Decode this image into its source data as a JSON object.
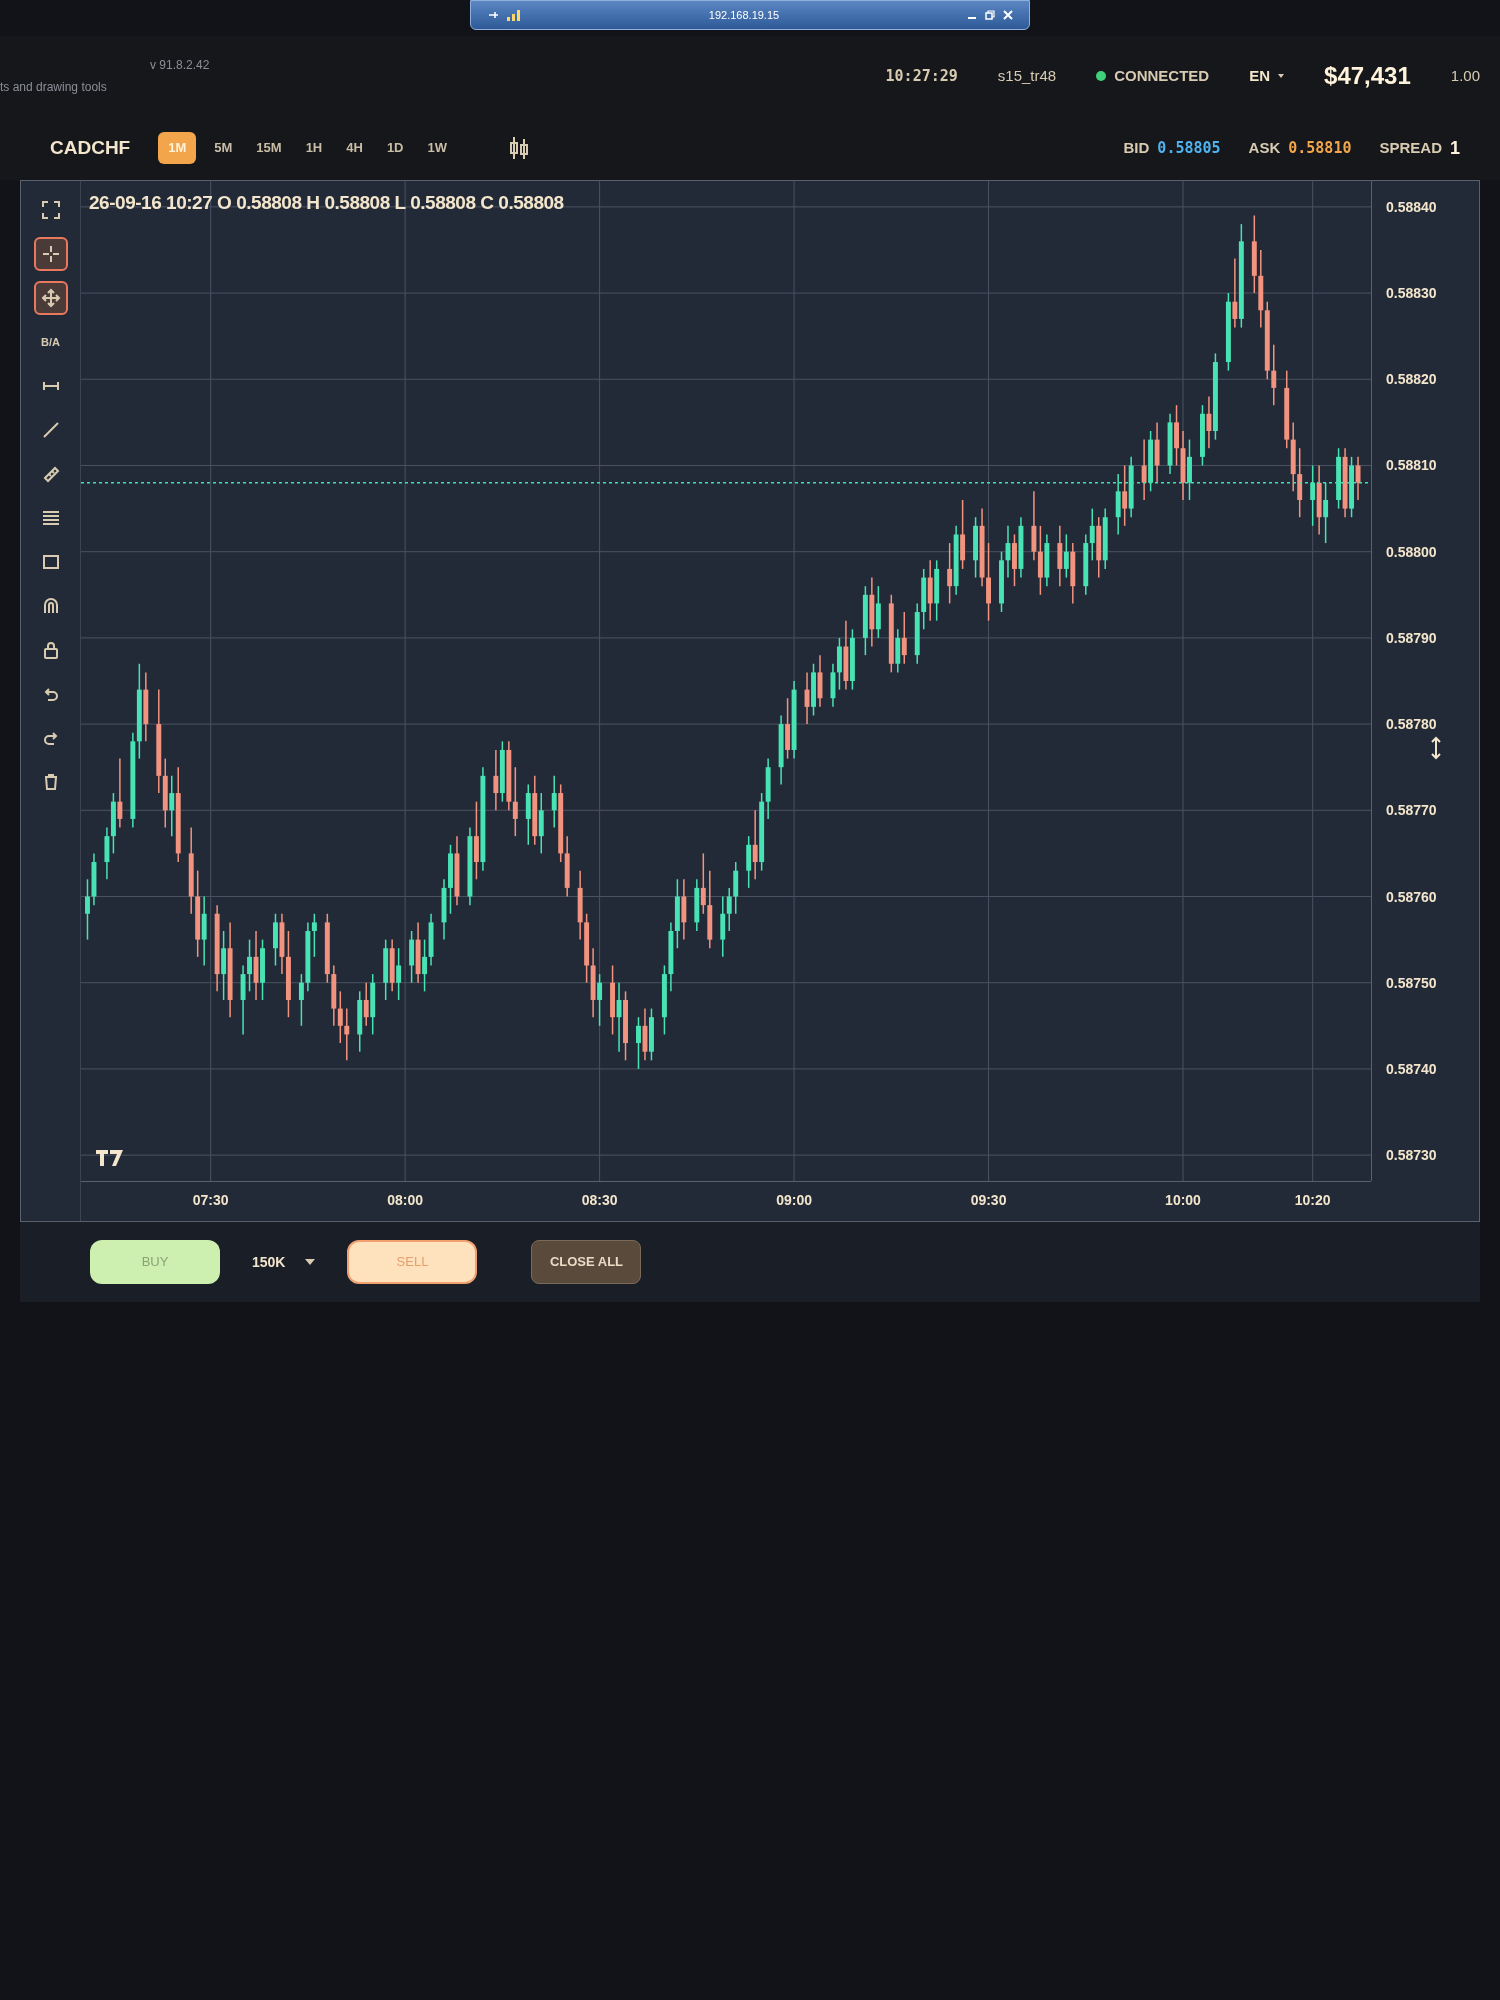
{
  "remote_bar": {
    "title": "192.168.19.15"
  },
  "header": {
    "tools_hint": "ts and drawing tools",
    "version": "v 91.8.2.42",
    "time": "10:27:29",
    "user": "s15_tr48",
    "connection": {
      "label": "CONNECTED",
      "connected": true
    },
    "language": "EN",
    "balance": "$47,431",
    "leverage": "1.00"
  },
  "toolbar": {
    "symbol": "CADCHF",
    "timeframes": [
      {
        "label": "1M",
        "selected": true
      },
      {
        "label": "5M",
        "selected": false
      },
      {
        "label": "15M",
        "selected": false
      },
      {
        "label": "1H",
        "selected": false
      },
      {
        "label": "4H",
        "selected": false
      },
      {
        "label": "1D",
        "selected": false
      },
      {
        "label": "1W",
        "selected": false
      }
    ],
    "quote": {
      "bid_label": "BID",
      "bid": "0.58805",
      "ask_label": "ASK",
      "ask": "0.58810",
      "spread_label": "SPREAD",
      "spread": "1"
    }
  },
  "drawing_tools": [
    {
      "kind": "icon",
      "selected": false
    },
    {
      "kind": "icon",
      "selected": true
    },
    {
      "kind": "icon",
      "selected": true
    },
    {
      "kind": "text",
      "label": "B/A",
      "selected": false
    },
    {
      "kind": "icon",
      "selected": false
    },
    {
      "kind": "icon",
      "selected": false
    },
    {
      "kind": "icon",
      "selected": false
    },
    {
      "kind": "icon",
      "selected": false
    },
    {
      "kind": "icon",
      "selected": false
    },
    {
      "kind": "icon",
      "selected": false
    },
    {
      "kind": "icon",
      "selected": false
    },
    {
      "kind": "icon",
      "selected": false
    },
    {
      "kind": "icon",
      "selected": false
    },
    {
      "kind": "icon",
      "selected": false
    }
  ],
  "chart": {
    "ohlc": "26-09-16 10:27 O 0.58808 H 0.58808 L 0.58808 C 0.58808",
    "chart_data": {
      "type": "candlestick",
      "xlim": [
        430,
        629
      ],
      "ylim": [
        0.58727,
        0.58843
      ],
      "grid": true,
      "ref_lines": [
        {
          "axis": "y",
          "value": 0.58808
        }
      ],
      "yticks": [
        {
          "value": 0.5884,
          "label": "0.58840"
        },
        {
          "value": 0.5883,
          "label": "0.58830"
        },
        {
          "value": 0.5882,
          "label": "0.58820"
        },
        {
          "value": 0.5881,
          "label": "0.58810"
        },
        {
          "value": 0.588,
          "label": "0.58800"
        },
        {
          "value": 0.5879,
          "label": "0.58790"
        },
        {
          "value": 0.5878,
          "label": "0.58780"
        },
        {
          "value": 0.5877,
          "label": "0.58770"
        },
        {
          "value": 0.5876,
          "label": "0.58760"
        },
        {
          "value": 0.5875,
          "label": "0.58750"
        },
        {
          "value": 0.5874,
          "label": "0.58740"
        },
        {
          "value": 0.5873,
          "label": "0.58730"
        }
      ],
      "xticks": [
        {
          "value": 450,
          "label": "07:30"
        },
        {
          "value": 480,
          "label": "08:00"
        },
        {
          "value": 510,
          "label": "08:30"
        },
        {
          "value": 540,
          "label": "09:00"
        },
        {
          "value": 570,
          "label": "09:30"
        },
        {
          "value": 600,
          "label": "10:00"
        },
        {
          "value": 620,
          "label": "10:20"
        }
      ],
      "x": [
        431,
        432,
        434,
        435,
        436,
        438,
        439,
        440,
        442,
        443,
        444,
        445,
        447,
        448,
        449,
        451,
        452,
        453,
        455,
        456,
        457,
        458,
        460,
        461,
        462,
        464,
        465,
        466,
        468,
        469,
        470,
        471,
        473,
        474,
        475,
        477,
        478,
        479,
        481,
        482,
        483,
        484,
        486,
        487,
        488,
        490,
        491,
        492,
        494,
        495,
        496,
        497,
        499,
        500,
        501,
        503,
        504,
        505,
        507,
        508,
        509,
        510,
        512,
        513,
        514,
        516,
        517,
        518,
        520,
        521,
        522,
        523,
        525,
        526,
        527,
        529,
        530,
        531,
        533,
        534,
        535,
        536,
        538,
        539,
        540,
        542,
        543,
        544,
        546,
        547,
        548,
        549,
        551,
        552,
        553,
        555,
        556,
        557,
        559,
        560,
        561,
        562,
        564,
        565,
        566,
        568,
        569,
        570,
        572,
        573,
        574,
        575,
        577,
        578,
        579,
        581,
        582,
        583,
        585,
        586,
        587,
        588,
        590,
        591,
        592,
        594,
        595,
        596,
        598,
        599,
        600,
        601,
        603,
        604,
        605,
        607,
        608,
        609,
        611,
        612,
        613,
        614,
        616,
        617,
        618,
        620,
        621,
        622,
        624,
        625,
        626,
        627
      ],
      "ohlc": [
        [
          0.58758,
          0.58762,
          0.58755,
          0.5876
        ],
        [
          0.5876,
          0.58765,
          0.58759,
          0.58764
        ],
        [
          0.58764,
          0.58768,
          0.58762,
          0.58767
        ],
        [
          0.58767,
          0.58772,
          0.58765,
          0.58771
        ],
        [
          0.58771,
          0.58776,
          0.58768,
          0.58769
        ],
        [
          0.58769,
          0.58779,
          0.58768,
          0.58778
        ],
        [
          0.58778,
          0.58787,
          0.58776,
          0.58784
        ],
        [
          0.58784,
          0.58786,
          0.58778,
          0.5878
        ],
        [
          0.5878,
          0.58784,
          0.58772,
          0.58774
        ],
        [
          0.58774,
          0.58776,
          0.58768,
          0.5877
        ],
        [
          0.5877,
          0.58774,
          0.58767,
          0.58772
        ],
        [
          0.58772,
          0.58775,
          0.58764,
          0.58765
        ],
        [
          0.58765,
          0.58768,
          0.58758,
          0.5876
        ],
        [
          0.5876,
          0.58763,
          0.58753,
          0.58755
        ],
        [
          0.58755,
          0.5876,
          0.58752,
          0.58758
        ],
        [
          0.58758,
          0.58759,
          0.58749,
          0.58751
        ],
        [
          0.58751,
          0.58756,
          0.58748,
          0.58754
        ],
        [
          0.58754,
          0.58757,
          0.58746,
          0.58748
        ],
        [
          0.58748,
          0.58752,
          0.58744,
          0.58751
        ],
        [
          0.58751,
          0.58755,
          0.58749,
          0.58753
        ],
        [
          0.58753,
          0.58756,
          0.58748,
          0.5875
        ],
        [
          0.5875,
          0.58755,
          0.58748,
          0.58754
        ],
        [
          0.58754,
          0.58758,
          0.58752,
          0.58757
        ],
        [
          0.58757,
          0.58758,
          0.58751,
          0.58753
        ],
        [
          0.58753,
          0.58756,
          0.58746,
          0.58748
        ],
        [
          0.58748,
          0.58751,
          0.58745,
          0.5875
        ],
        [
          0.5875,
          0.58757,
          0.58749,
          0.58756
        ],
        [
          0.58756,
          0.58758,
          0.58753,
          0.58757
        ],
        [
          0.58757,
          0.58758,
          0.5875,
          0.58751
        ],
        [
          0.58751,
          0.58752,
          0.58745,
          0.58747
        ],
        [
          0.58747,
          0.58749,
          0.58743,
          0.58745
        ],
        [
          0.58745,
          0.58747,
          0.58741,
          0.58744
        ],
        [
          0.58744,
          0.58749,
          0.58742,
          0.58748
        ],
        [
          0.58748,
          0.5875,
          0.58745,
          0.58746
        ],
        [
          0.58746,
          0.58751,
          0.58744,
          0.5875
        ],
        [
          0.5875,
          0.58755,
          0.58748,
          0.58754
        ],
        [
          0.58754,
          0.58755,
          0.58749,
          0.5875
        ],
        [
          0.5875,
          0.58754,
          0.58748,
          0.58752
        ],
        [
          0.58752,
          0.58756,
          0.5875,
          0.58755
        ],
        [
          0.58755,
          0.58757,
          0.5875,
          0.58751
        ],
        [
          0.58751,
          0.58755,
          0.58749,
          0.58753
        ],
        [
          0.58753,
          0.58758,
          0.58752,
          0.58757
        ],
        [
          0.58757,
          0.58762,
          0.58755,
          0.58761
        ],
        [
          0.58761,
          0.58766,
          0.58758,
          0.58765
        ],
        [
          0.58765,
          0.58767,
          0.58759,
          0.5876
        ],
        [
          0.5876,
          0.58768,
          0.58759,
          0.58767
        ],
        [
          0.58767,
          0.58771,
          0.58762,
          0.58764
        ],
        [
          0.58764,
          0.58775,
          0.58763,
          0.58774
        ],
        [
          0.58774,
          0.58777,
          0.5877,
          0.58772
        ],
        [
          0.58772,
          0.58778,
          0.58771,
          0.58777
        ],
        [
          0.58777,
          0.58778,
          0.5877,
          0.58771
        ],
        [
          0.58771,
          0.58775,
          0.58767,
          0.58769
        ],
        [
          0.58769,
          0.58773,
          0.58766,
          0.58772
        ],
        [
          0.58772,
          0.58774,
          0.58766,
          0.58767
        ],
        [
          0.58767,
          0.58772,
          0.58765,
          0.5877
        ],
        [
          0.5877,
          0.58774,
          0.58768,
          0.58772
        ],
        [
          0.58772,
          0.58773,
          0.58764,
          0.58765
        ],
        [
          0.58765,
          0.58767,
          0.5876,
          0.58761
        ],
        [
          0.58761,
          0.58763,
          0.58755,
          0.58757
        ],
        [
          0.58757,
          0.58758,
          0.5875,
          0.58752
        ],
        [
          0.58752,
          0.58754,
          0.58746,
          0.58748
        ],
        [
          0.58748,
          0.58751,
          0.58745,
          0.5875
        ],
        [
          0.5875,
          0.58752,
          0.58744,
          0.58746
        ],
        [
          0.58746,
          0.5875,
          0.58742,
          0.58748
        ],
        [
          0.58748,
          0.58749,
          0.58741,
          0.58743
        ],
        [
          0.58743,
          0.58746,
          0.5874,
          0.58745
        ],
        [
          0.58745,
          0.58747,
          0.58741,
          0.58742
        ],
        [
          0.58742,
          0.58747,
          0.58741,
          0.58746
        ],
        [
          0.58746,
          0.58752,
          0.58744,
          0.58751
        ],
        [
          0.58751,
          0.58757,
          0.58749,
          0.58756
        ],
        [
          0.58756,
          0.58762,
          0.58754,
          0.5876
        ],
        [
          0.5876,
          0.58762,
          0.58755,
          0.58757
        ],
        [
          0.58757,
          0.58762,
          0.58756,
          0.58761
        ],
        [
          0.58761,
          0.58765,
          0.58758,
          0.58759
        ],
        [
          0.58759,
          0.58763,
          0.58754,
          0.58755
        ],
        [
          0.58755,
          0.5876,
          0.58753,
          0.58758
        ],
        [
          0.58758,
          0.58761,
          0.58756,
          0.5876
        ],
        [
          0.5876,
          0.58764,
          0.58758,
          0.58763
        ],
        [
          0.58763,
          0.58767,
          0.58761,
          0.58766
        ],
        [
          0.58766,
          0.5877,
          0.58762,
          0.58764
        ],
        [
          0.58764,
          0.58772,
          0.58763,
          0.58771
        ],
        [
          0.58771,
          0.58776,
          0.58769,
          0.58775
        ],
        [
          0.58775,
          0.58781,
          0.58773,
          0.5878
        ],
        [
          0.5878,
          0.58783,
          0.58776,
          0.58777
        ],
        [
          0.58777,
          0.58785,
          0.58776,
          0.58784
        ],
        [
          0.58784,
          0.58786,
          0.5878,
          0.58782
        ],
        [
          0.58782,
          0.58787,
          0.58781,
          0.58786
        ],
        [
          0.58786,
          0.58788,
          0.58782,
          0.58783
        ],
        [
          0.58783,
          0.58787,
          0.58782,
          0.58786
        ],
        [
          0.58786,
          0.5879,
          0.58784,
          0.58789
        ],
        [
          0.58789,
          0.58792,
          0.58784,
          0.58785
        ],
        [
          0.58785,
          0.58791,
          0.58784,
          0.5879
        ],
        [
          0.5879,
          0.58796,
          0.58788,
          0.58795
        ],
        [
          0.58795,
          0.58797,
          0.58789,
          0.58791
        ],
        [
          0.58791,
          0.58796,
          0.5879,
          0.58794
        ],
        [
          0.58794,
          0.58795,
          0.58786,
          0.58787
        ],
        [
          0.58787,
          0.58791,
          0.58786,
          0.5879
        ],
        [
          0.5879,
          0.58793,
          0.58787,
          0.58788
        ],
        [
          0.58788,
          0.58794,
          0.58787,
          0.58793
        ],
        [
          0.58793,
          0.58798,
          0.58791,
          0.58797
        ],
        [
          0.58797,
          0.58799,
          0.58792,
          0.58794
        ],
        [
          0.58794,
          0.58799,
          0.58792,
          0.58798
        ],
        [
          0.58798,
          0.58801,
          0.58794,
          0.58796
        ],
        [
          0.58796,
          0.58803,
          0.58795,
          0.58802
        ],
        [
          0.58802,
          0.58806,
          0.58798,
          0.58799
        ],
        [
          0.58799,
          0.58804,
          0.58797,
          0.58803
        ],
        [
          0.58803,
          0.58805,
          0.58796,
          0.58797
        ],
        [
          0.58797,
          0.58801,
          0.58792,
          0.58794
        ],
        [
          0.58794,
          0.588,
          0.58793,
          0.58799
        ],
        [
          0.58799,
          0.58803,
          0.58797,
          0.58801
        ],
        [
          0.58801,
          0.58802,
          0.58796,
          0.58798
        ],
        [
          0.58798,
          0.58804,
          0.58797,
          0.58803
        ],
        [
          0.58803,
          0.58807,
          0.58799,
          0.588
        ],
        [
          0.588,
          0.58803,
          0.58795,
          0.58797
        ],
        [
          0.58797,
          0.58802,
          0.58796,
          0.58801
        ],
        [
          0.58801,
          0.58803,
          0.58796,
          0.58798
        ],
        [
          0.58798,
          0.58802,
          0.58797,
          0.588
        ],
        [
          0.588,
          0.58801,
          0.58794,
          0.58796
        ],
        [
          0.58796,
          0.58802,
          0.58795,
          0.58801
        ],
        [
          0.58801,
          0.58805,
          0.58799,
          0.58803
        ],
        [
          0.58803,
          0.58804,
          0.58797,
          0.58799
        ],
        [
          0.58799,
          0.58805,
          0.58798,
          0.58804
        ],
        [
          0.58804,
          0.58809,
          0.58802,
          0.58807
        ],
        [
          0.58807,
          0.5881,
          0.58803,
          0.58805
        ],
        [
          0.58805,
          0.58811,
          0.58804,
          0.5881
        ],
        [
          0.5881,
          0.58813,
          0.58806,
          0.58808
        ],
        [
          0.58808,
          0.58814,
          0.58807,
          0.58813
        ],
        [
          0.58813,
          0.58815,
          0.58808,
          0.5881
        ],
        [
          0.5881,
          0.58816,
          0.58809,
          0.58815
        ],
        [
          0.58815,
          0.58817,
          0.5881,
          0.58812
        ],
        [
          0.58812,
          0.58814,
          0.58806,
          0.58808
        ],
        [
          0.58808,
          0.58813,
          0.58806,
          0.58811
        ],
        [
          0.58811,
          0.58817,
          0.5881,
          0.58816
        ],
        [
          0.58816,
          0.58818,
          0.58812,
          0.58814
        ],
        [
          0.58814,
          0.58823,
          0.58813,
          0.58822
        ],
        [
          0.58822,
          0.5883,
          0.58821,
          0.58829
        ],
        [
          0.58829,
          0.58834,
          0.58826,
          0.58827
        ],
        [
          0.58827,
          0.58838,
          0.58826,
          0.58836
        ],
        [
          0.58836,
          0.58839,
          0.5883,
          0.58832
        ],
        [
          0.58832,
          0.58835,
          0.58826,
          0.58828
        ],
        [
          0.58828,
          0.58829,
          0.5882,
          0.58821
        ],
        [
          0.58821,
          0.58824,
          0.58817,
          0.58819
        ],
        [
          0.58819,
          0.58821,
          0.58812,
          0.58813
        ],
        [
          0.58813,
          0.58815,
          0.58807,
          0.58809
        ],
        [
          0.58809,
          0.58812,
          0.58804,
          0.58806
        ],
        [
          0.58806,
          0.5881,
          0.58803,
          0.58808
        ],
        [
          0.58808,
          0.5881,
          0.58802,
          0.58804
        ],
        [
          0.58804,
          0.58808,
          0.58801,
          0.58806
        ],
        [
          0.58806,
          0.58812,
          0.58805,
          0.58811
        ],
        [
          0.58811,
          0.58812,
          0.58804,
          0.58805
        ],
        [
          0.58805,
          0.58811,
          0.58804,
          0.5881
        ],
        [
          0.5881,
          0.58811,
          0.58806,
          0.58808
        ]
      ]
    }
  },
  "order_bar": {
    "buy": "BUY",
    "lot_size": "150K",
    "sell": "SELL",
    "close_all": "CLOSE ALL"
  }
}
